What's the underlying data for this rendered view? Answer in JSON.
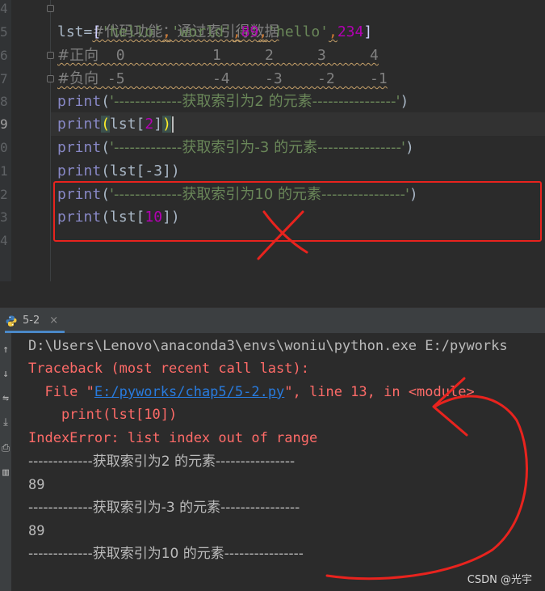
{
  "editor": {
    "line_numbers": [
      "4",
      "5",
      "6",
      "7",
      "8",
      "9",
      "0",
      "1",
      "2",
      "3",
      "4"
    ],
    "lines": {
      "l4_comment": "#代码功能：通过索引得数据",
      "l5_var": "lst",
      "l5_eq": "=",
      "l5_open": "[",
      "l5_s1": "'hello'",
      "l5_s2": "'world'",
      "l5_n1": "89",
      "l5_s3": "'hello'",
      "l5_n2": "234",
      "l5_close": "]",
      "l5_comma": ",",
      "l6_comment_a": "#正向",
      "l6_comment_b": "  0          1     2     3     4",
      "l7_comment_a": "#负向",
      "l7_comment_b": " -5          -4    -3    -2    -1",
      "print": "print",
      "l8_arg": "'-------------获取索引为2 的元素----------------'",
      "l9_open": "(",
      "l9_arr": "lst[",
      "l9_idx": "2",
      "l9_close_b": "]",
      "l9_close_p": ")",
      "l10_arg": "'-------------获取索引为-3 的元素----------------'",
      "l11_arr": "(lst[",
      "l11_idx": "-3",
      "l11_close": "])",
      "l12_arg": "'-------------获取索引为10 的元素----------------'",
      "l13_arr": "(lst[",
      "l13_idx": "10",
      "l13_close": "])",
      "paren_open": "(",
      "paren_close": ")"
    }
  },
  "run_panel": {
    "tab_label": "5-2",
    "tab_close": "×",
    "output": {
      "cmd": "D:\\Users\\Lenovo\\anaconda3\\envs\\woniu\\python.exe E:/pyworks",
      "traceback": "Traceback (most recent call last):",
      "file_prefix": "  File \"",
      "file_link": "E:/pyworks/chap5/5-2.py",
      "file_suffix": "\", line 13, in <module>",
      "stmt": "    print(lst[10])",
      "error": "IndexError: list index out of range",
      "out1": "-------------获取索引为2 的元素----------------",
      "val1": "89",
      "out2": "-------------获取索引为-3 的元素----------------",
      "val2": "89",
      "out3": "-------------获取索引为10 的元素----------------"
    }
  },
  "watermark": "CSDN @光宇",
  "colors": {
    "annotation_red": "#e8231e",
    "error_text": "#ff6b68",
    "link": "#287bde"
  }
}
